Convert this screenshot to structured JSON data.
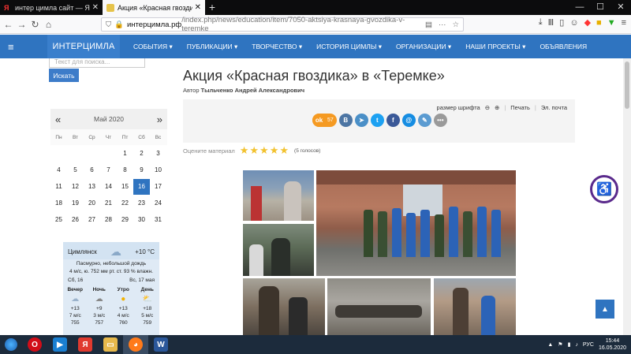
{
  "browser": {
    "tabs": [
      {
        "title": "интер цимла сайт — Яндекс: н",
        "active": false
      },
      {
        "title": "Акция «Красная гвоздика» в «Т",
        "active": true
      }
    ],
    "new_tab": "+",
    "url_host": "интерцимла.рф",
    "url_path": "/index.php/news/education/item/7050-aktsiya-krasnaya-gvozdika-v-teremke"
  },
  "site": {
    "logo": "ИНТЕРЦИМЛА",
    "menu": [
      "СОБЫТИЯ ▾",
      "ПУБЛИКАЦИИ ▾",
      "ТВОРЧЕСТВО ▾",
      "ИСТОРИЯ ЦИМЛЫ ▾",
      "ОРГАНИЗАЦИИ ▾",
      "НАШИ ПРОЕКТЫ ▾",
      "ОБЪЯВЛЕНИЯ"
    ]
  },
  "sidebar": {
    "search_placeholder": "Текст для поиска...",
    "search_button": "Искать",
    "calendar": {
      "month": "Май 2020",
      "prev": "«",
      "next": "»",
      "dow": [
        "Пн",
        "Вт",
        "Ср",
        "Чт",
        "Пт",
        "Сб",
        "Вс"
      ],
      "weeks": [
        [
          "",
          "",
          "",
          "",
          "1",
          "2",
          "3"
        ],
        [
          "4",
          "5",
          "6",
          "7",
          "8",
          "9",
          "10"
        ],
        [
          "11",
          "12",
          "13",
          "14",
          "15",
          "16",
          "17"
        ],
        [
          "18",
          "19",
          "20",
          "21",
          "22",
          "23",
          "24"
        ],
        [
          "25",
          "26",
          "27",
          "28",
          "29",
          "30",
          "31"
        ]
      ],
      "today": "16"
    },
    "weather": {
      "city": "Цимлянск",
      "temp_now": "+10 °C",
      "desc": "Пасмурно, небольшой дождь",
      "details": "4 м/с, ю.   752 мм рт. ст.   93 % влажн.",
      "day1": "Сб, 16",
      "day2": "Вс, 17 мая",
      "cols": [
        {
          "name": "Вечер",
          "temp": "+13",
          "wind": "7 м/с",
          "press": "755"
        },
        {
          "name": "Ночь",
          "temp": "+9",
          "wind": "3 м/с",
          "press": "757"
        },
        {
          "name": "Утро",
          "temp": "+13",
          "wind": "4 м/с",
          "press": "760"
        },
        {
          "name": "День",
          "temp": "+18",
          "wind": "5 м/с",
          "press": "759"
        }
      ]
    }
  },
  "article": {
    "title": "Акция «Красная гвоздика» в «Теремке»",
    "author_label": "Автор",
    "author": "Тыльченко Андрей Александрович",
    "font_size_label": "размер шрифта",
    "print": "Печать",
    "email": "Эл. почта",
    "ok_count": "57",
    "rate_label": "Оцените материал",
    "votes": "(5 голосов)"
  },
  "taskbar": {
    "lang": "РУС",
    "time": "15:44",
    "date": "16.05.2020"
  },
  "colors": {
    "header": "#2f74c0",
    "tabbar": "#0c0c0d",
    "taskbar": "#1c2b3c"
  }
}
